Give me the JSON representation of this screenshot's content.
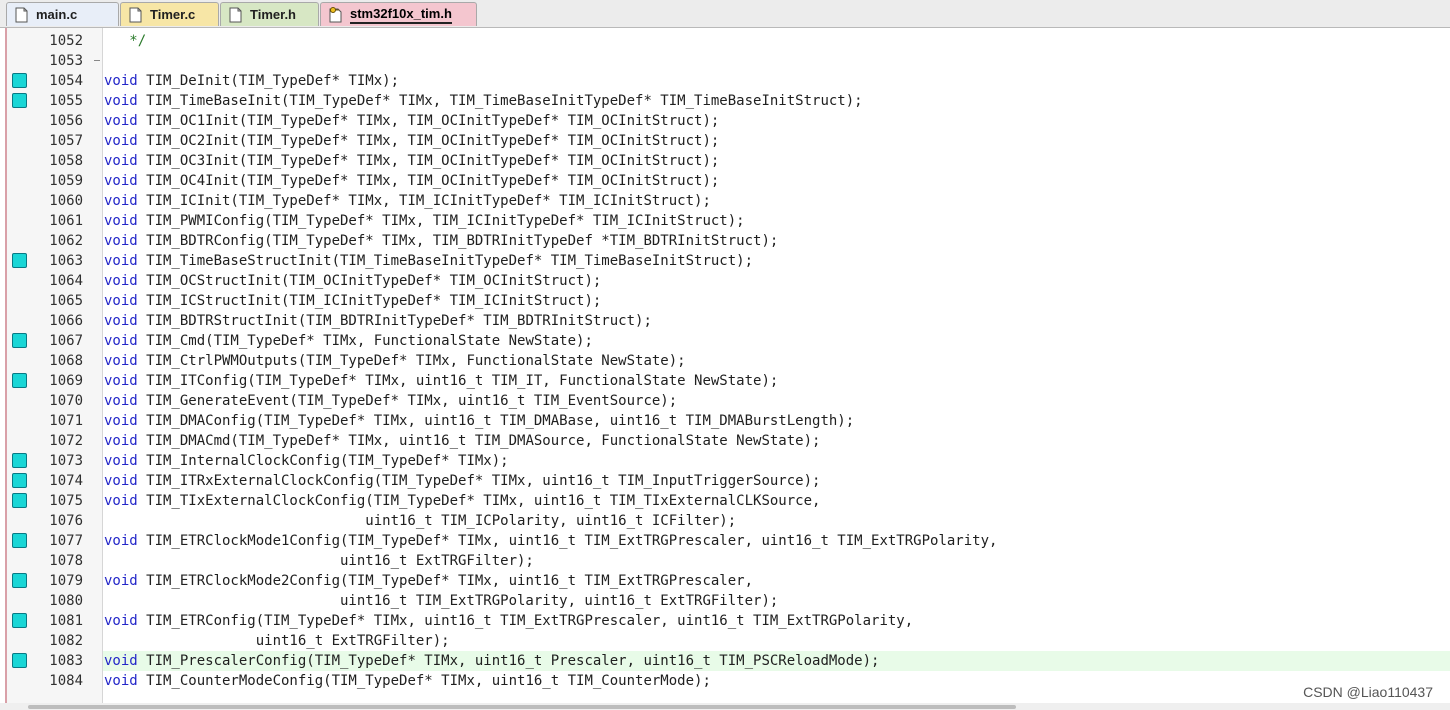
{
  "tabs": [
    {
      "label": "main.c",
      "bg": "#e8eef8",
      "icon": "c-file-icon",
      "active": false
    },
    {
      "label": "Timer.c",
      "bg": "#f7e6a6",
      "icon": "c-file-icon",
      "active": false
    },
    {
      "label": "Timer.h",
      "bg": "#d7e7c4",
      "icon": "h-file-icon",
      "active": false
    },
    {
      "label": "stm32f10x_tim.h",
      "bg": "#f4c6cf",
      "icon": "locked-h-file-icon",
      "active": true
    }
  ],
  "colors": {
    "keyword": "#2326c9",
    "breakpoint": "#19d6d6",
    "highlight_line": "#e8fbe8",
    "active_tab_border": "#d9a0a8"
  },
  "lines": [
    {
      "n": "1052",
      "text": "   */",
      "bp": false,
      "comment": true
    },
    {
      "n": "1053",
      "text": "",
      "bp": false,
      "fold": true
    },
    {
      "n": "1054",
      "text": "void TIM_DeInit(TIM_TypeDef* TIMx);",
      "bp": true
    },
    {
      "n": "1055",
      "text": "void TIM_TimeBaseInit(TIM_TypeDef* TIMx, TIM_TimeBaseInitTypeDef* TIM_TimeBaseInitStruct);",
      "bp": true
    },
    {
      "n": "1056",
      "text": "void TIM_OC1Init(TIM_TypeDef* TIMx, TIM_OCInitTypeDef* TIM_OCInitStruct);",
      "bp": false
    },
    {
      "n": "1057",
      "text": "void TIM_OC2Init(TIM_TypeDef* TIMx, TIM_OCInitTypeDef* TIM_OCInitStruct);",
      "bp": false
    },
    {
      "n": "1058",
      "text": "void TIM_OC3Init(TIM_TypeDef* TIMx, TIM_OCInitTypeDef* TIM_OCInitStruct);",
      "bp": false
    },
    {
      "n": "1059",
      "text": "void TIM_OC4Init(TIM_TypeDef* TIMx, TIM_OCInitTypeDef* TIM_OCInitStruct);",
      "bp": false
    },
    {
      "n": "1060",
      "text": "void TIM_ICInit(TIM_TypeDef* TIMx, TIM_ICInitTypeDef* TIM_ICInitStruct);",
      "bp": false
    },
    {
      "n": "1061",
      "text": "void TIM_PWMIConfig(TIM_TypeDef* TIMx, TIM_ICInitTypeDef* TIM_ICInitStruct);",
      "bp": false
    },
    {
      "n": "1062",
      "text": "void TIM_BDTRConfig(TIM_TypeDef* TIMx, TIM_BDTRInitTypeDef *TIM_BDTRInitStruct);",
      "bp": false
    },
    {
      "n": "1063",
      "text": "void TIM_TimeBaseStructInit(TIM_TimeBaseInitTypeDef* TIM_TimeBaseInitStruct);",
      "bp": true
    },
    {
      "n": "1064",
      "text": "void TIM_OCStructInit(TIM_OCInitTypeDef* TIM_OCInitStruct);",
      "bp": false
    },
    {
      "n": "1065",
      "text": "void TIM_ICStructInit(TIM_ICInitTypeDef* TIM_ICInitStruct);",
      "bp": false
    },
    {
      "n": "1066",
      "text": "void TIM_BDTRStructInit(TIM_BDTRInitTypeDef* TIM_BDTRInitStruct);",
      "bp": false
    },
    {
      "n": "1067",
      "text": "void TIM_Cmd(TIM_TypeDef* TIMx, FunctionalState NewState);",
      "bp": true
    },
    {
      "n": "1068",
      "text": "void TIM_CtrlPWMOutputs(TIM_TypeDef* TIMx, FunctionalState NewState);",
      "bp": false
    },
    {
      "n": "1069",
      "text": "void TIM_ITConfig(TIM_TypeDef* TIMx, uint16_t TIM_IT, FunctionalState NewState);",
      "bp": true
    },
    {
      "n": "1070",
      "text": "void TIM_GenerateEvent(TIM_TypeDef* TIMx, uint16_t TIM_EventSource);",
      "bp": false
    },
    {
      "n": "1071",
      "text": "void TIM_DMAConfig(TIM_TypeDef* TIMx, uint16_t TIM_DMABase, uint16_t TIM_DMABurstLength);",
      "bp": false
    },
    {
      "n": "1072",
      "text": "void TIM_DMACmd(TIM_TypeDef* TIMx, uint16_t TIM_DMASource, FunctionalState NewState);",
      "bp": false
    },
    {
      "n": "1073",
      "text": "void TIM_InternalClockConfig(TIM_TypeDef* TIMx);",
      "bp": true
    },
    {
      "n": "1074",
      "text": "void TIM_ITRxExternalClockConfig(TIM_TypeDef* TIMx, uint16_t TIM_InputTriggerSource);",
      "bp": true
    },
    {
      "n": "1075",
      "text": "void TIM_TIxExternalClockConfig(TIM_TypeDef* TIMx, uint16_t TIM_TIxExternalCLKSource,",
      "bp": true
    },
    {
      "n": "1076",
      "text": "                               uint16_t TIM_ICPolarity, uint16_t ICFilter);",
      "bp": false
    },
    {
      "n": "1077",
      "text": "void TIM_ETRClockMode1Config(TIM_TypeDef* TIMx, uint16_t TIM_ExtTRGPrescaler, uint16_t TIM_ExtTRGPolarity,",
      "bp": true
    },
    {
      "n": "1078",
      "text": "                            uint16_t ExtTRGFilter);",
      "bp": false
    },
    {
      "n": "1079",
      "text": "void TIM_ETRClockMode2Config(TIM_TypeDef* TIMx, uint16_t TIM_ExtTRGPrescaler,",
      "bp": true
    },
    {
      "n": "1080",
      "text": "                            uint16_t TIM_ExtTRGPolarity, uint16_t ExtTRGFilter);",
      "bp": false
    },
    {
      "n": "1081",
      "text": "void TIM_ETRConfig(TIM_TypeDef* TIMx, uint16_t TIM_ExtTRGPrescaler, uint16_t TIM_ExtTRGPolarity,",
      "bp": true
    },
    {
      "n": "1082",
      "text": "                  uint16_t ExtTRGFilter);",
      "bp": false
    },
    {
      "n": "1083",
      "text": "void TIM_PrescalerConfig(TIM_TypeDef* TIMx, uint16_t Prescaler, uint16_t TIM_PSCReloadMode);",
      "bp": true,
      "highlight": true
    },
    {
      "n": "1084",
      "text": "void TIM_CounterModeConfig(TIM_TypeDef* TIMx, uint16_t TIM_CounterMode);",
      "bp": false
    }
  ],
  "watermark": "CSDN @Liao110437"
}
